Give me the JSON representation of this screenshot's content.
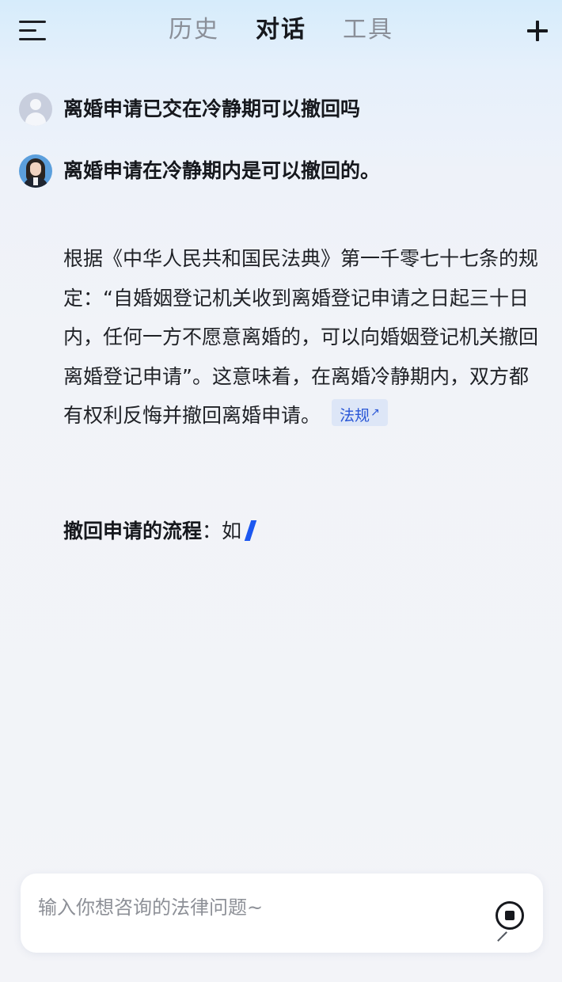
{
  "header": {
    "tabs": [
      {
        "label": "历史",
        "active": false
      },
      {
        "label": "对话",
        "active": true
      },
      {
        "label": "工具",
        "active": false
      }
    ],
    "menu_icon": "menu-icon",
    "new_chat_icon": "plus-icon"
  },
  "conversation": {
    "user_question": "离婚申请已交在冷静期可以撤回吗",
    "ai_headline": "离婚申请在冷静期内是可以撤回的。",
    "ai_paragraph": "根据《中华人民共和国民法典》第一千零七十七条的规定：“自婚姻登记机关收到离婚登记申请之日起三十日内，任何一方不愿意离婚的，可以向婚姻登记机关撤回离婚登记申请”。这意味着，在离婚冷静期内，双方都有权利反悔并撤回离婚申请。",
    "law_tag": "法规",
    "process_label": "撤回申请的流程",
    "process_partial": "：如"
  },
  "composer": {
    "placeholder": "输入你想咨询的法律问题~",
    "stop_icon": "stop-icon"
  },
  "colors": {
    "accent": "#1c57f0",
    "tag_text": "#2a57d6",
    "tag_bg": "#dde6f7"
  }
}
